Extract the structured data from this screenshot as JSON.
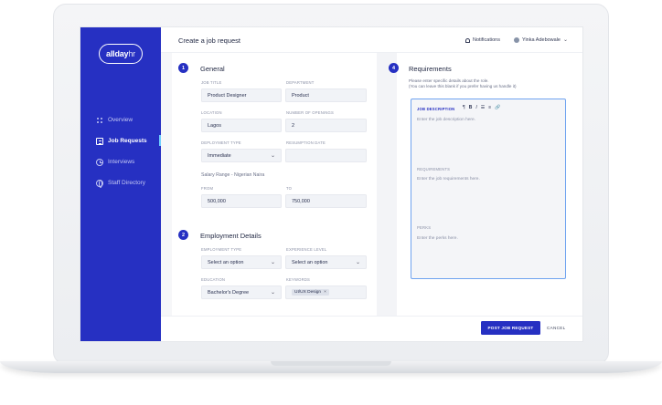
{
  "brand": {
    "logo_bold": "allday",
    "logo_suffix": "hr"
  },
  "sidebar": {
    "items": [
      {
        "label": "Overview",
        "icon": "grid-icon",
        "active": false
      },
      {
        "label": "Job Requests",
        "icon": "document-icon",
        "active": true
      },
      {
        "label": "Interviews",
        "icon": "clock-icon",
        "active": false
      },
      {
        "label": "Staff Directory",
        "icon": "globe-icon",
        "active": false
      }
    ]
  },
  "header": {
    "title": "Create a job request",
    "notifications_label": "Notifications",
    "user_name": "Yinka Adebowale"
  },
  "general": {
    "step": "1",
    "title": "General",
    "job_title": {
      "label": "JOB TITLE",
      "value": "Product Designer"
    },
    "department": {
      "label": "DEPARTMENT",
      "value": "Product"
    },
    "location": {
      "label": "LOCATION",
      "value": "Lagos"
    },
    "openings": {
      "label": "NUMBER OF OPENINGS",
      "value": "2"
    },
    "deployment_type": {
      "label": "DEPLOYMENT TYPE",
      "value": "Immediate"
    },
    "resumption_date": {
      "label": "RESUMPTION DATE",
      "value": ""
    },
    "salary_note": "Salary Range - Nigerian Naira",
    "from": {
      "label": "FROM",
      "value": "500,000"
    },
    "to": {
      "label": "TO",
      "value": "750,000"
    }
  },
  "employment": {
    "step": "2",
    "title": "Employment Details",
    "employment_type": {
      "label": "EMPLOYMENT TYPE",
      "value": "Select an option"
    },
    "experience_level": {
      "label": "EXPERIENCE LEVEL",
      "value": "Select an option"
    },
    "education": {
      "label": "EDUCATION",
      "value": "Bachelor's Degree"
    },
    "keywords": {
      "label": "KEYWORDS",
      "chip": "UI/UX Design"
    }
  },
  "requirements": {
    "step": "4",
    "title": "Requirements",
    "desc_line1": "Please enter specific details about the role.",
    "desc_line2": "(You can leave this blank if you prefer having us handle it)",
    "job_description": {
      "label": "JOB DESCRIPTION",
      "placeholder": "Enter the job description here."
    },
    "requirements_field": {
      "label": "REQUIREMENTS",
      "placeholder": "Enter the job requirements here."
    },
    "perks": {
      "label": "PERKS",
      "placeholder": "Enter the perks here."
    },
    "toolbar": [
      "¶",
      "B",
      "I",
      "☰",
      "≡",
      "🔗"
    ]
  },
  "footer": {
    "post_label": "POST JOB REQUEST",
    "cancel_label": "CANCEL"
  },
  "colors": {
    "primary": "#2630c2",
    "accent": "#6fd0ff",
    "editor_border": "#6fa3f0"
  }
}
